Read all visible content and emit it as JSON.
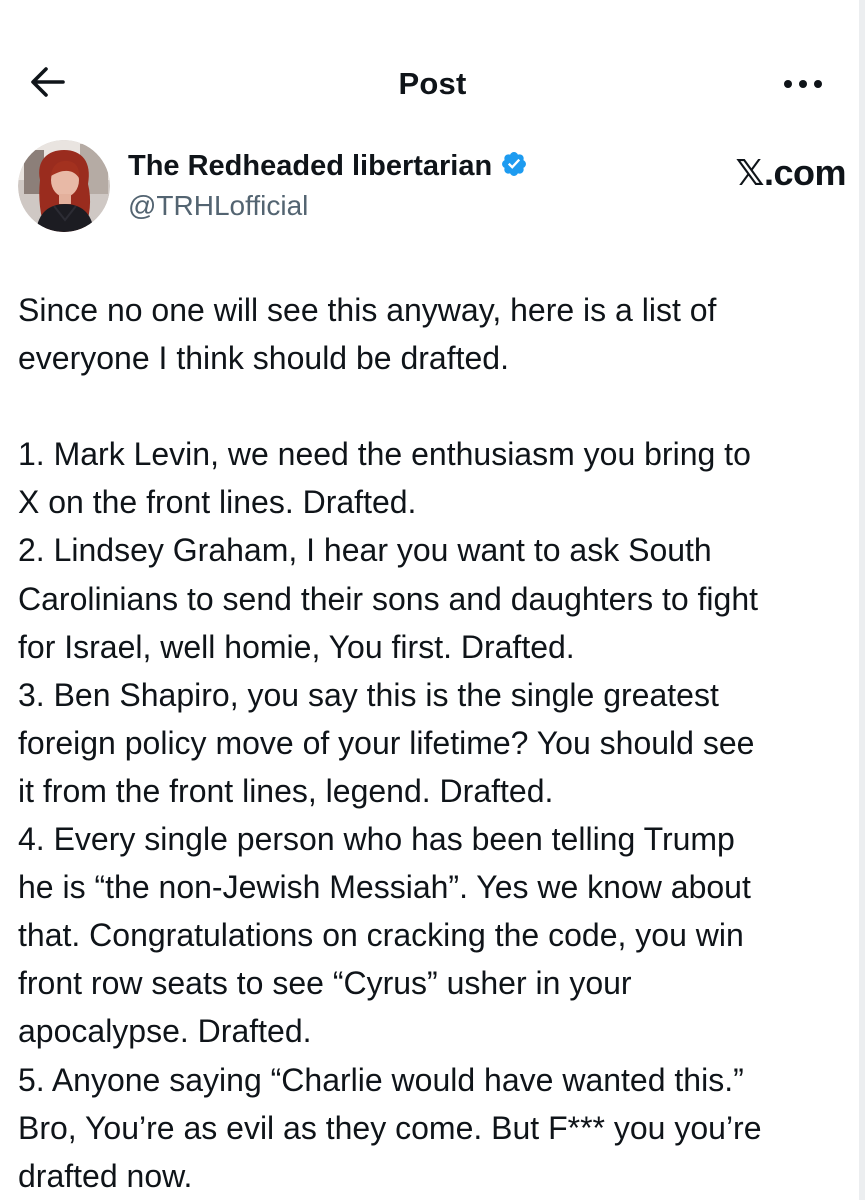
{
  "topbar": {
    "back_icon": "back-arrow-icon",
    "title": "Post",
    "more_icon": "more-horizontal-icon"
  },
  "author": {
    "display_name": "The Redheaded libertarian",
    "handle": "@TRHLofficial",
    "verified_icon": "verified-badge-icon",
    "verified_color": "#1d9bf0"
  },
  "source_label": "𝕏.com",
  "tweet": {
    "lines": [
      "Since no one will see this anyway, here is a list of",
      "everyone I think should be drafted.",
      "",
      "1. Mark Levin, we need the enthusiasm you bring to",
      "X on the front lines. Drafted.",
      "2. Lindsey Graham, I hear you want to ask South",
      "Carolinians to send their sons and daughters to fight",
      "for Israel, well homie, You first. Drafted.",
      "3. Ben Shapiro, you say this is the single greatest",
      "foreign policy move of your lifetime? You should see",
      "it from the front lines, legend. Drafted.",
      "4. Every single person who has been telling Trump",
      "he is “the non-Jewish Messiah”. Yes we know about",
      "that. Congratulations on cracking the code, you win",
      "front row seats to see “Cyrus” usher in your",
      "apocalypse. Drafted.",
      "5. Anyone saying “Charlie would have wanted this.”",
      "Bro, You’re as evil as they come. But F*** you you’re",
      "drafted now."
    ]
  },
  "colors": {
    "text_primary": "#0f1419",
    "text_secondary": "#536471",
    "background": "#ffffff"
  }
}
